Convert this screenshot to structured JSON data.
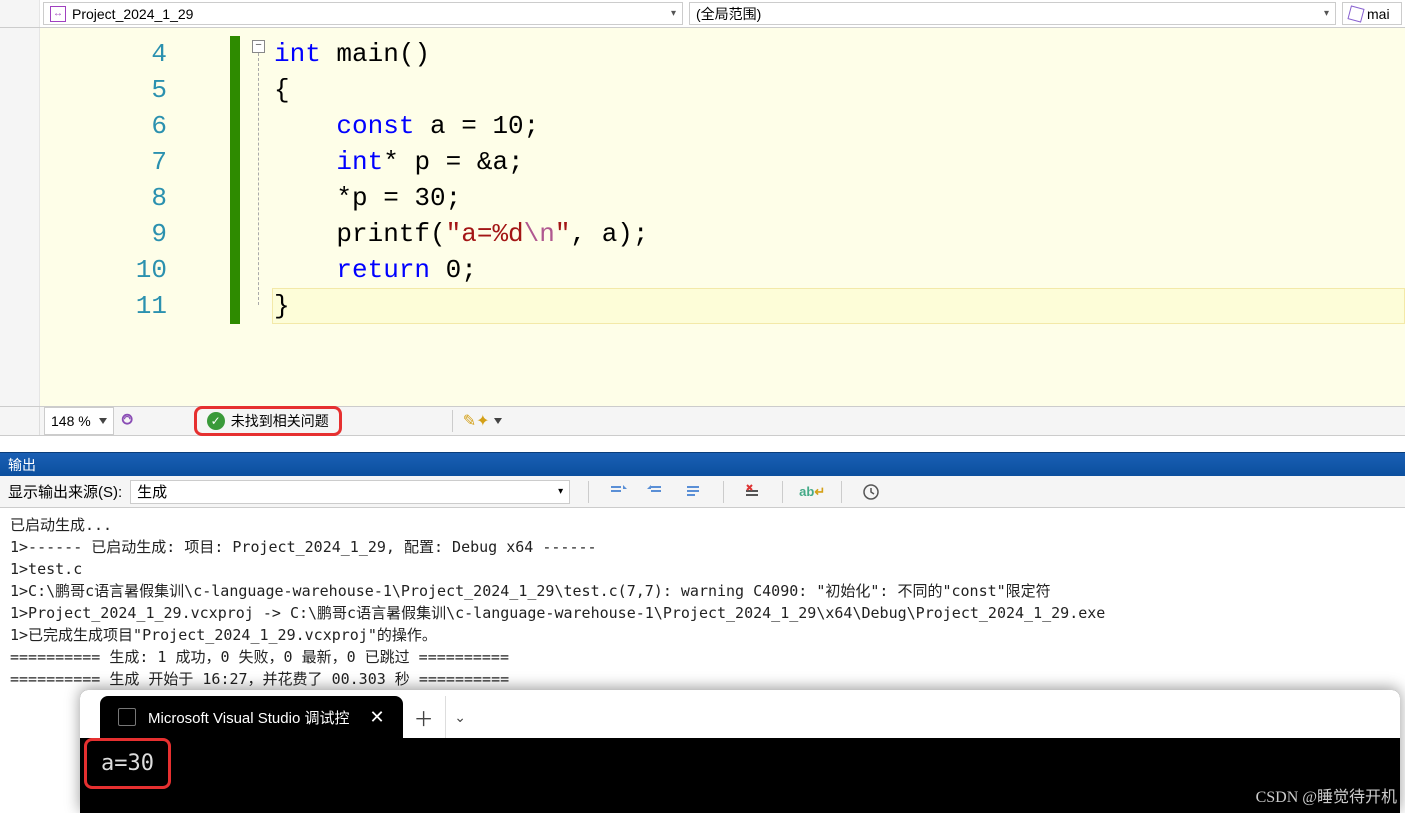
{
  "nav": {
    "project_label": "Project_2024_1_29",
    "scope_label": "(全局范围)",
    "function_label": "mai"
  },
  "editor": {
    "line_start": 4,
    "line_end": 11,
    "code_lines": [
      {
        "tokens": [
          {
            "t": "int",
            "c": "kw"
          },
          {
            "t": " ",
            "c": ""
          },
          {
            "t": "main",
            "c": "fn"
          },
          {
            "t": "()",
            "c": ""
          }
        ]
      },
      {
        "tokens": [
          {
            "t": "{",
            "c": ""
          }
        ]
      },
      {
        "tokens": [
          {
            "t": "    ",
            "c": ""
          },
          {
            "t": "const",
            "c": "kw"
          },
          {
            "t": " a = 10;",
            "c": ""
          }
        ]
      },
      {
        "tokens": [
          {
            "t": "    ",
            "c": ""
          },
          {
            "t": "int",
            "c": "kw"
          },
          {
            "t": "* p = &a;",
            "c": ""
          }
        ]
      },
      {
        "tokens": [
          {
            "t": "    *p = 30;",
            "c": ""
          }
        ]
      },
      {
        "tokens": [
          {
            "t": "    printf(",
            "c": ""
          },
          {
            "t": "\"a=%d",
            "c": "str"
          },
          {
            "t": "\\n",
            "c": "esc"
          },
          {
            "t": "\"",
            "c": "str"
          },
          {
            "t": ", a);",
            "c": ""
          }
        ]
      },
      {
        "tokens": [
          {
            "t": "    ",
            "c": ""
          },
          {
            "t": "return",
            "c": "kw"
          },
          {
            "t": " 0;",
            "c": ""
          }
        ]
      },
      {
        "tokens": [
          {
            "t": "}",
            "c": ""
          }
        ]
      }
    ]
  },
  "status": {
    "zoom": "148 %",
    "issues_text": "未找到相关问题"
  },
  "output": {
    "panel_title": "输出",
    "source_label": "显示输出来源(S):",
    "source_value": "生成",
    "lines": [
      "已启动生成...",
      "1>------ 已启动生成: 项目: Project_2024_1_29, 配置: Debug x64 ------",
      "1>test.c",
      "1>C:\\鹏哥c语言暑假集训\\c-language-warehouse-1\\Project_2024_1_29\\test.c(7,7): warning C4090: \"初始化\": 不同的\"const\"限定符",
      "1>Project_2024_1_29.vcxproj -> C:\\鹏哥c语言暑假集训\\c-language-warehouse-1\\Project_2024_1_29\\x64\\Debug\\Project_2024_1_29.exe",
      "1>已完成生成项目\"Project_2024_1_29.vcxproj\"的操作。",
      "========== 生成: 1 成功，0 失败，0 最新，0 已跳过 ==========",
      "========== 生成 开始于 16:27，并花费了 00.303 秒 =========="
    ]
  },
  "terminal": {
    "tab_title": "Microsoft Visual Studio 调试控",
    "output": "a=30"
  },
  "watermark": "CSDN @睡觉待开机"
}
